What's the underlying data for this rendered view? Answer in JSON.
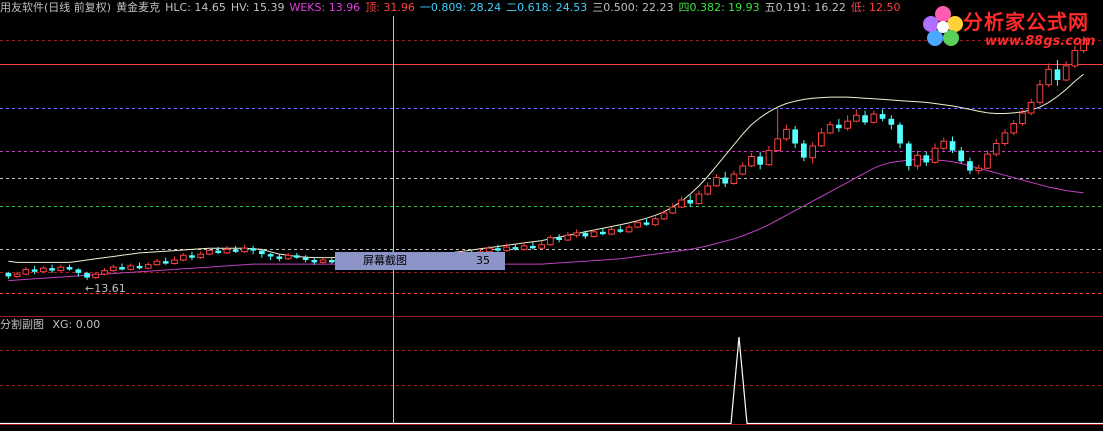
{
  "header": {
    "items": [
      {
        "text": "用友软件(日线 前复权)",
        "color": "#c0c0c0"
      },
      {
        "text": "黄金麦克",
        "color": "#c0c0c0"
      },
      {
        "text": "HLC: 14.65",
        "color": "#c0c0c0"
      },
      {
        "text": "HV: 15.39",
        "color": "#c0c0c0"
      },
      {
        "text": "WEKS: 13.96",
        "color": "#e040e0"
      },
      {
        "text": "顶: 31.96",
        "color": "#ff4040"
      },
      {
        "text": "一0.809: 28.24",
        "color": "#40d0ff"
      },
      {
        "text": "二0.618: 24.53",
        "color": "#40d0ff"
      },
      {
        "text": "三0.500: 22.23",
        "color": "#c0c0c0"
      },
      {
        "text": "四0.382: 19.93",
        "color": "#40e040"
      },
      {
        "text": "五0.191: 16.22",
        "color": "#c0c0c0"
      },
      {
        "text": "低: 12.50",
        "color": "#ff4040"
      }
    ]
  },
  "logo": {
    "brand": "分析家公式网",
    "url": "www.88gs.com"
  },
  "tooltip": {
    "label": "屏幕截图",
    "value": "35"
  },
  "low_marker": "←13.61",
  "sub_panel": {
    "title": "分割副图",
    "indicator": "XG: 0.00"
  },
  "colors": {
    "up": "#ff4040",
    "down": "#54ffff",
    "upper_band": "#f0f0d0",
    "lower_band": "#c040c0",
    "grid_red": "#a02020",
    "cursor": "#c0c0c0"
  },
  "chart_data": {
    "type": "candlestick",
    "price_range": [
      11.9,
      34.0
    ],
    "fib_levels": [
      {
        "name": "顶",
        "value": 31.96,
        "color": "#ff4040",
        "style": "solid"
      },
      {
        "name": "一0.809",
        "value": 28.24,
        "color": "#7070ff",
        "style": "dashed"
      },
      {
        "name": "二0.618",
        "value": 24.53,
        "color": "#c040c0",
        "style": "dashed"
      },
      {
        "name": "三0.500",
        "value": 22.23,
        "color": "#c0c0c0",
        "style": "dashed"
      },
      {
        "name": "四0.382",
        "value": 19.93,
        "color": "#40c040",
        "style": "dashed"
      },
      {
        "name": "五0.191",
        "value": 16.22,
        "color": "#c0c0c0",
        "style": "dashed"
      },
      {
        "name": "低",
        "value": 12.5,
        "color": "#ff4040",
        "style": "dashed"
      }
    ],
    "extra_gridlines": [
      34.0,
      14.3
    ],
    "candles": [
      [
        14.2,
        13.9,
        14.3,
        13.7
      ],
      [
        13.9,
        14.1,
        14.3,
        13.8
      ],
      [
        14.1,
        14.5,
        14.7,
        14.0
      ],
      [
        14.5,
        14.3,
        14.8,
        14.1
      ],
      [
        14.3,
        14.6,
        14.8,
        14.2
      ],
      [
        14.6,
        14.4,
        14.9,
        14.2
      ],
      [
        14.4,
        14.7,
        14.9,
        14.3
      ],
      [
        14.7,
        14.5,
        14.9,
        14.4
      ],
      [
        14.5,
        14.2,
        14.6,
        13.9
      ],
      [
        14.2,
        13.8,
        14.3,
        13.61
      ],
      [
        13.8,
        14.1,
        14.3,
        13.7
      ],
      [
        14.1,
        14.4,
        14.6,
        14.0
      ],
      [
        14.4,
        14.7,
        14.9,
        14.3
      ],
      [
        14.7,
        14.5,
        15.0,
        14.4
      ],
      [
        14.5,
        14.8,
        15.0,
        14.4
      ],
      [
        14.8,
        14.6,
        15.1,
        14.5
      ],
      [
        14.6,
        14.9,
        15.1,
        14.5
      ],
      [
        14.9,
        15.2,
        15.4,
        14.8
      ],
      [
        15.2,
        15.0,
        15.5,
        14.9
      ],
      [
        15.0,
        15.3,
        15.6,
        14.9
      ],
      [
        15.3,
        15.7,
        15.9,
        15.2
      ],
      [
        15.7,
        15.5,
        16.0,
        15.3
      ],
      [
        15.5,
        15.8,
        16.0,
        15.4
      ],
      [
        15.8,
        16.1,
        16.3,
        15.7
      ],
      [
        16.1,
        15.9,
        16.4,
        15.8
      ],
      [
        15.9,
        16.2,
        16.5,
        15.8
      ],
      [
        16.2,
        16.0,
        16.5,
        15.9
      ],
      [
        16.0,
        16.3,
        16.6,
        15.9
      ],
      [
        16.3,
        16.1,
        16.5,
        15.8
      ],
      [
        16.1,
        15.8,
        16.2,
        15.5
      ],
      [
        15.8,
        15.6,
        15.9,
        15.3
      ],
      [
        15.6,
        15.4,
        15.8,
        15.2
      ],
      [
        15.4,
        15.7,
        15.9,
        15.3
      ],
      [
        15.7,
        15.5,
        15.9,
        15.4
      ],
      [
        15.5,
        15.3,
        15.7,
        15.1
      ],
      [
        15.3,
        15.1,
        15.5,
        14.9
      ],
      [
        15.1,
        15.3,
        15.5,
        15.0
      ],
      [
        15.3,
        15.1,
        15.5,
        15.0
      ],
      [
        15.1,
        15.4,
        15.6,
        15.0
      ],
      [
        15.4,
        15.2,
        15.6,
        15.1
      ],
      [
        15.2,
        15.5,
        15.7,
        15.1
      ],
      [
        15.5,
        15.3,
        15.7,
        15.2
      ],
      [
        15.3,
        15.6,
        15.8,
        15.2
      ],
      [
        15.6,
        15.8,
        16.0,
        15.5
      ],
      [
        15.8,
        15.6,
        16.1,
        15.5
      ],
      [
        15.6,
        15.4,
        15.8,
        15.3
      ],
      [
        15.4,
        15.2,
        15.6,
        15.1
      ],
      [
        15.2,
        15.0,
        15.4,
        14.9
      ],
      [
        15.0,
        15.2,
        15.4,
        14.9
      ],
      [
        15.2,
        15.0,
        15.4,
        14.9
      ],
      [
        15.0,
        15.3,
        15.5,
        14.9
      ],
      [
        15.3,
        15.6,
        15.8,
        15.2
      ],
      [
        15.6,
        15.9,
        16.1,
        15.5
      ],
      [
        15.9,
        15.7,
        16.2,
        15.6
      ],
      [
        15.7,
        16.0,
        16.2,
        15.6
      ],
      [
        16.0,
        16.3,
        16.5,
        15.9
      ],
      [
        16.3,
        16.1,
        16.6,
        16.0
      ],
      [
        16.1,
        16.4,
        16.7,
        16.0
      ],
      [
        16.4,
        16.2,
        16.6,
        16.1
      ],
      [
        16.2,
        16.5,
        16.8,
        16.1
      ],
      [
        16.5,
        16.3,
        16.8,
        16.2
      ],
      [
        16.3,
        16.6,
        16.9,
        16.2
      ],
      [
        16.6,
        17.2,
        17.4,
        16.5
      ],
      [
        17.2,
        17.0,
        17.5,
        16.8
      ],
      [
        17.0,
        17.4,
        17.7,
        16.9
      ],
      [
        17.4,
        17.6,
        17.9,
        17.2
      ],
      [
        17.6,
        17.3,
        17.8,
        17.1
      ],
      [
        17.3,
        17.7,
        17.9,
        17.2
      ],
      [
        17.7,
        17.5,
        18.0,
        17.4
      ],
      [
        17.5,
        17.9,
        18.1,
        17.4
      ],
      [
        17.9,
        17.7,
        18.2,
        17.6
      ],
      [
        17.7,
        18.1,
        18.3,
        17.6
      ],
      [
        18.1,
        18.5,
        18.7,
        18.0
      ],
      [
        18.5,
        18.3,
        18.8,
        18.2
      ],
      [
        18.3,
        18.8,
        19.0,
        18.2
      ],
      [
        18.8,
        19.3,
        19.5,
        18.7
      ],
      [
        19.3,
        19.8,
        20.1,
        19.2
      ],
      [
        19.8,
        20.4,
        20.7,
        19.7
      ],
      [
        20.4,
        20.1,
        20.8,
        19.8
      ],
      [
        20.1,
        20.9,
        21.2,
        20.0
      ],
      [
        20.9,
        21.6,
        21.9,
        20.8
      ],
      [
        21.6,
        22.3,
        22.6,
        21.5
      ],
      [
        22.3,
        21.8,
        22.8,
        21.5
      ],
      [
        21.8,
        22.6,
        22.9,
        21.7
      ],
      [
        22.6,
        23.3,
        23.6,
        22.5
      ],
      [
        23.3,
        24.1,
        24.4,
        23.2
      ],
      [
        24.1,
        23.4,
        24.5,
        23.0
      ],
      [
        23.4,
        24.6,
        25.0,
        23.3
      ],
      [
        24.6,
        25.6,
        28.2,
        24.5
      ],
      [
        25.6,
        26.4,
        26.8,
        25.4
      ],
      [
        26.4,
        25.2,
        26.7,
        24.8
      ],
      [
        25.2,
        24.0,
        25.5,
        23.7
      ],
      [
        24.0,
        25.0,
        25.3,
        23.5
      ],
      [
        25.0,
        26.1,
        26.5,
        24.9
      ],
      [
        26.1,
        26.8,
        27.1,
        26.0
      ],
      [
        26.8,
        26.5,
        27.3,
        26.2
      ],
      [
        26.5,
        27.1,
        27.6,
        26.3
      ],
      [
        27.1,
        27.6,
        28.1,
        27.0
      ],
      [
        27.6,
        27.0,
        28.0,
        26.8
      ],
      [
        27.0,
        27.7,
        28.0,
        26.9
      ],
      [
        27.7,
        27.3,
        28.1,
        27.1
      ],
      [
        27.3,
        26.8,
        27.6,
        26.4
      ],
      [
        26.8,
        25.2,
        27.0,
        24.8
      ],
      [
        25.2,
        23.3,
        25.4,
        22.9
      ],
      [
        23.3,
        24.2,
        24.6,
        23.0
      ],
      [
        24.2,
        23.6,
        24.5,
        23.3
      ],
      [
        23.6,
        24.8,
        25.2,
        23.5
      ],
      [
        24.8,
        25.4,
        25.7,
        24.6
      ],
      [
        25.4,
        24.6,
        25.8,
        24.4
      ],
      [
        24.6,
        23.7,
        24.9,
        23.5
      ],
      [
        23.7,
        22.9,
        24.0,
        22.6
      ],
      [
        22.9,
        23.1,
        23.4,
        22.6
      ],
      [
        23.1,
        24.3,
        24.6,
        23.0
      ],
      [
        24.3,
        25.2,
        25.6,
        24.1
      ],
      [
        25.2,
        26.1,
        26.4,
        25.0
      ],
      [
        26.1,
        26.9,
        27.2,
        25.9
      ],
      [
        26.9,
        27.8,
        28.1,
        26.7
      ],
      [
        27.8,
        28.7,
        29.0,
        27.6
      ],
      [
        28.7,
        30.2,
        30.6,
        28.5
      ],
      [
        30.2,
        31.5,
        32.0,
        30.0
      ],
      [
        31.5,
        30.6,
        32.3,
        30.1
      ],
      [
        30.6,
        31.8,
        32.2,
        30.5
      ],
      [
        31.8,
        33.1,
        33.5,
        31.6
      ],
      [
        33.1,
        34.0,
        34.3,
        32.9
      ]
    ],
    "upper_band": [
      15.2,
      15.1,
      15.1,
      15.1,
      15.1,
      15.1,
      15.1,
      15.1,
      15.2,
      15.3,
      15.4,
      15.5,
      15.6,
      15.7,
      15.8,
      15.9,
      15.95,
      16.0,
      16.05,
      16.1,
      16.15,
      16.2,
      16.25,
      16.3,
      16.3,
      16.3,
      16.3,
      16.3,
      16.25,
      16.2,
      16.0,
      15.8,
      15.7,
      15.6,
      15.55,
      15.5,
      15.5,
      15.5,
      15.55,
      15.6,
      15.65,
      15.7,
      15.75,
      15.8,
      15.85,
      15.9,
      15.9,
      15.85,
      15.8,
      15.8,
      15.85,
      15.95,
      16.05,
      16.15,
      16.25,
      16.35,
      16.45,
      16.55,
      16.65,
      16.75,
      16.85,
      16.95,
      17.1,
      17.25,
      17.4,
      17.55,
      17.7,
      17.85,
      18.0,
      18.15,
      18.3,
      18.45,
      18.65,
      18.85,
      19.1,
      19.4,
      19.8,
      20.3,
      20.9,
      21.6,
      22.4,
      23.3,
      24.2,
      25.1,
      26.0,
      26.8,
      27.4,
      27.9,
      28.3,
      28.6,
      28.8,
      28.95,
      29.05,
      29.1,
      29.15,
      29.15,
      29.15,
      29.1,
      29.05,
      29.0,
      28.95,
      28.9,
      28.85,
      28.8,
      28.75,
      28.7,
      28.6,
      28.5,
      28.4,
      28.25,
      28.1,
      27.95,
      27.8,
      27.75,
      27.75,
      27.8,
      27.9,
      28.05,
      28.3,
      28.7,
      29.2,
      29.8,
      30.5,
      31.1
    ],
    "lower_band": [
      13.55,
      13.6,
      13.65,
      13.7,
      13.75,
      13.8,
      13.85,
      13.9,
      13.95,
      14.0,
      14.05,
      14.1,
      14.15,
      14.2,
      14.25,
      14.3,
      14.35,
      14.4,
      14.45,
      14.5,
      14.55,
      14.6,
      14.65,
      14.7,
      14.75,
      14.8,
      14.85,
      14.9,
      14.95,
      14.95,
      14.95,
      14.95,
      14.95,
      14.95,
      14.95,
      14.95,
      14.95,
      14.95,
      14.95,
      14.95,
      14.95,
      14.95,
      14.95,
      14.95,
      14.95,
      14.95,
      14.95,
      14.95,
      14.95,
      14.95,
      14.95,
      14.95,
      14.95,
      14.95,
      14.95,
      14.95,
      14.95,
      14.95,
      14.95,
      14.95,
      14.95,
      14.95,
      15.0,
      15.05,
      15.1,
      15.15,
      15.2,
      15.25,
      15.3,
      15.35,
      15.4,
      15.5,
      15.6,
      15.7,
      15.8,
      15.9,
      16.0,
      16.1,
      16.2,
      16.35,
      16.5,
      16.7,
      16.9,
      17.1,
      17.35,
      17.65,
      17.95,
      18.3,
      18.7,
      19.1,
      19.5,
      19.9,
      20.3,
      20.7,
      21.1,
      21.5,
      21.9,
      22.3,
      22.7,
      23.1,
      23.4,
      23.6,
      23.7,
      23.8,
      23.85,
      23.85,
      23.8,
      23.75,
      23.65,
      23.5,
      23.3,
      23.1,
      22.9,
      22.7,
      22.5,
      22.3,
      22.1,
      21.9,
      21.7,
      21.5,
      21.35,
      21.2,
      21.1,
      21.0
    ],
    "xg_signal": {
      "x_fraction": 0.67,
      "value": 1
    },
    "low_marker_index": 9,
    "cursor_index": 44,
    "tooltip_index": 44
  }
}
